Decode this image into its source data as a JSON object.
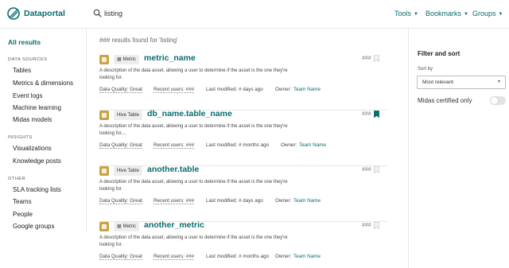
{
  "header": {
    "brand": "Dataportal",
    "search_value": "listing",
    "nav": [
      "Tools",
      "Bookmarks",
      "Groups"
    ]
  },
  "sidebar": {
    "all_results": "All results",
    "sections": [
      {
        "heading": "DATA SOURCES",
        "items": [
          "Tables",
          "Metrics & dimensions",
          "Event logs",
          "Machine learning",
          "Midas models"
        ]
      },
      {
        "heading": "INSIGHTS",
        "items": [
          "Visualizations",
          "Knowledge posts"
        ]
      },
      {
        "heading": "OTHER",
        "items": [
          "SLA tracking lists",
          "Teams",
          "People",
          "Google groups"
        ]
      }
    ]
  },
  "results": {
    "count_text": "### results found for 'listing'",
    "items": [
      {
        "badge": "Metric",
        "badge_icon": "grid-icon",
        "title": "metric_name",
        "score": "###",
        "bookmarked": false,
        "desc_line1": "A description of the data asset, allowing a user to determine if the asset is the one they're",
        "desc_line2": "looking for.",
        "quality": "Data Quality: Great",
        "recent_users": "Recent users: ###",
        "last_modified": "Last modified: # days ago",
        "owner_label": "Owner:",
        "owner": "Team Name"
      },
      {
        "badge": "Hive Table",
        "badge_icon": "",
        "title": "db_name.table_name",
        "score": "###",
        "bookmarked": true,
        "desc_line1": "A description of the data asset, allowing a user to determine if the asset is the one they're",
        "desc_line2": "looking for....",
        "quality": "Data Quality: Great",
        "recent_users": "Recent users: ###",
        "last_modified": "Last modified: # months ago",
        "owner_label": "Owner:",
        "owner": "Team Name"
      },
      {
        "badge": "Hive Table",
        "badge_icon": "",
        "title": "another.table",
        "score": "###",
        "bookmarked": false,
        "desc_line1": "A description of the data asset, allowing a user to determine if the asset is the one they're",
        "desc_line2": "looking for.",
        "quality": "Data Quality: Great",
        "recent_users": "Recent users: ###",
        "last_modified": "Last modified: # days ago",
        "owner_label": "Owner:",
        "owner": "Team Name"
      },
      {
        "badge": "Metric",
        "badge_icon": "grid-icon",
        "title": "another_metric",
        "score": "###",
        "bookmarked": false,
        "desc_line1": "A description of the data asset, allowing a user to determine if the asset is the one they're",
        "desc_line2": "looking for.",
        "quality": "Data Quality: Great",
        "recent_users": "Recent users: ###",
        "last_modified": "Last modified: # months ago",
        "owner_label": "Owner:",
        "owner": "Team Name"
      }
    ]
  },
  "filter": {
    "title": "Filter and sort",
    "sort_label": "Sort by",
    "sort_value": "Most relevant",
    "midas_label": "Midas certified only",
    "midas_on": false
  },
  "colors": {
    "accent": "#0b6b6e",
    "asset_icon": "#c9a24a",
    "badge_bg": "#ededed"
  }
}
